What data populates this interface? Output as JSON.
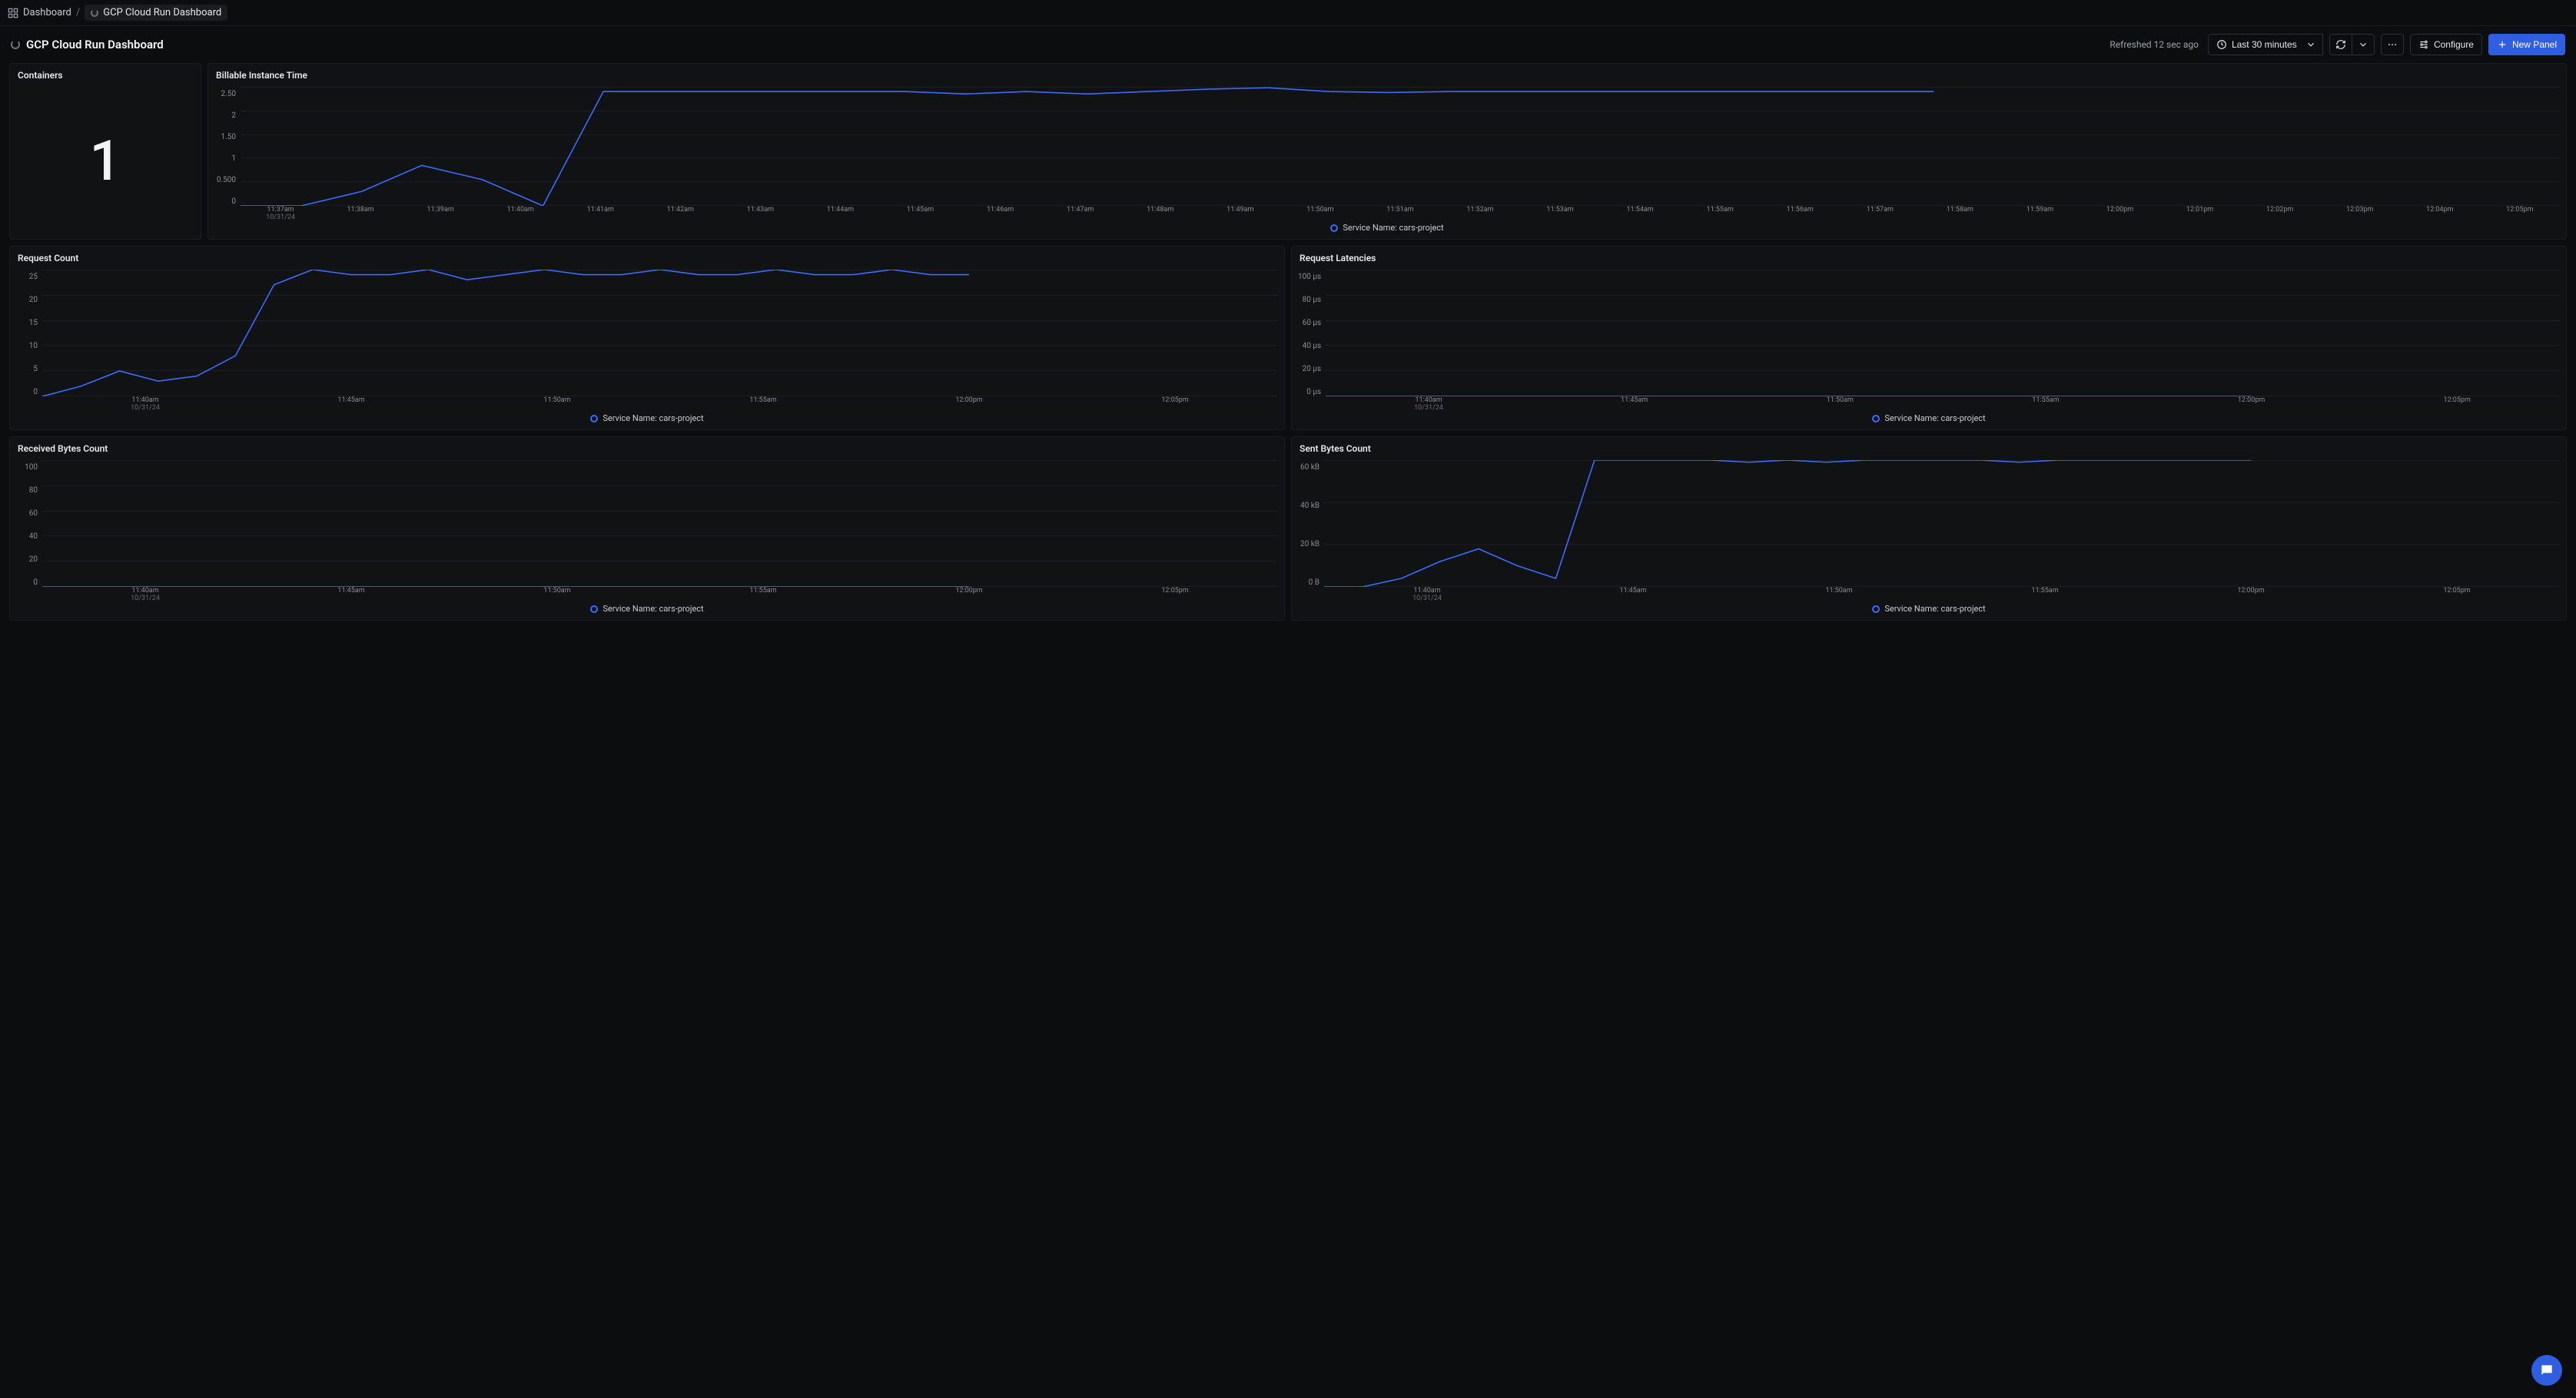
{
  "breadcrumb": {
    "root": "Dashboard",
    "sep": "/",
    "current": "GCP Cloud Run Dashboard"
  },
  "header": {
    "title": "GCP Cloud Run Dashboard",
    "refreshed": "Refreshed 12 sec ago",
    "range_label": "Last 30 minutes",
    "configure": "Configure",
    "new_panel": "New Panel"
  },
  "legend_label": "Service Name: cars-project",
  "date_label": "10/31/24",
  "panels": {
    "containers": {
      "title": "Containers",
      "value": "1"
    },
    "billable": {
      "title": "Billable Instance Time"
    },
    "req_count": {
      "title": "Request Count"
    },
    "req_lat": {
      "title": "Request Latencies"
    },
    "recv_bytes": {
      "title": "Received Bytes Count"
    },
    "sent_bytes": {
      "title": "Sent Bytes Count"
    }
  },
  "chart_data": [
    {
      "id": "billable",
      "type": "line",
      "title": "Billable Instance Time",
      "ylabel": "",
      "ylim": [
        0,
        2.5
      ],
      "yticks": [
        "2.50",
        "2",
        "1.50",
        "1",
        "0.500",
        "0"
      ],
      "xticks": [
        "11:37am",
        "11:38am",
        "11:39am",
        "11:40am",
        "11:41am",
        "11:42am",
        "11:43am",
        "11:44am",
        "11:45am",
        "11:46am",
        "11:47am",
        "11:48am",
        "11:49am",
        "11:50am",
        "11:51am",
        "11:52am",
        "11:53am",
        "11:54am",
        "11:55am",
        "11:56am",
        "11:57am",
        "11:58am",
        "11:59am",
        "12:00pm",
        "12:01pm",
        "12:02pm",
        "12:03pm",
        "12:04pm",
        "12:05pm"
      ],
      "series": [
        {
          "name": "Service Name: cars-project",
          "values": [
            0,
            0,
            0.3,
            0.85,
            0.55,
            0,
            2.4,
            2.4,
            2.4,
            2.4,
            2.4,
            2.4,
            2.35,
            2.4,
            2.35,
            2.4,
            2.45,
            2.48,
            2.4,
            2.38,
            2.4,
            2.4,
            2.4,
            2.4,
            2.4,
            2.4,
            2.4,
            2.4,
            2.4
          ]
        }
      ]
    },
    {
      "id": "req_count",
      "type": "line",
      "title": "Request Count",
      "ylim": [
        0,
        25
      ],
      "yticks": [
        "25",
        "20",
        "15",
        "10",
        "5",
        "0"
      ],
      "xticks": [
        "11:40am",
        "11:45am",
        "11:50am",
        "11:55am",
        "12:00pm",
        "12:05pm"
      ],
      "series": [
        {
          "name": "Service Name: cars-project",
          "values": [
            0,
            2,
            5,
            3,
            4,
            8,
            22,
            25,
            24,
            24,
            25,
            23,
            24,
            25,
            24,
            24,
            25,
            24,
            24,
            25,
            24,
            24,
            25,
            24,
            24
          ]
        }
      ]
    },
    {
      "id": "req_lat",
      "type": "line",
      "title": "Request Latencies",
      "ylim": [
        0,
        100
      ],
      "yticks": [
        "100 µs",
        "80 µs",
        "60 µs",
        "40 µs",
        "20 µs",
        "0 µs"
      ],
      "xticks": [
        "11:40am",
        "11:45am",
        "11:50am",
        "11:55am",
        "12:00pm",
        "12:05pm"
      ],
      "series": [
        {
          "name": "Service Name: cars-project",
          "values": [
            0,
            0,
            0,
            0,
            0,
            0,
            0,
            0,
            0,
            0,
            0,
            0,
            0,
            0,
            0,
            0,
            0,
            0,
            0,
            0,
            0,
            0,
            0,
            0,
            0
          ]
        }
      ]
    },
    {
      "id": "recv_bytes",
      "type": "line",
      "title": "Received Bytes Count",
      "ylim": [
        0,
        100
      ],
      "yticks": [
        "100",
        "80",
        "60",
        "40",
        "20",
        "0"
      ],
      "xticks": [
        "11:40am",
        "11:45am",
        "11:50am",
        "11:55am",
        "12:00pm",
        "12:05pm"
      ],
      "series": [
        {
          "name": "Service Name: cars-project",
          "values": [
            0,
            0,
            0,
            0,
            0,
            0,
            0,
            0,
            0,
            0,
            0,
            0,
            0,
            0,
            0,
            0,
            0,
            0,
            0,
            0,
            0,
            0,
            0,
            0,
            0
          ]
        }
      ]
    },
    {
      "id": "sent_bytes",
      "type": "line",
      "title": "Sent Bytes Count",
      "ylim": [
        0,
        60000
      ],
      "yticks": [
        "60 kB",
        "40 kB",
        "20 kB",
        "0 B"
      ],
      "xticks": [
        "11:40am",
        "11:45am",
        "11:50am",
        "11:55am",
        "12:00pm",
        "12:05pm"
      ],
      "series": [
        {
          "name": "Service Name: cars-project",
          "values": [
            0,
            0,
            4000,
            12000,
            18000,
            10000,
            4000,
            60000,
            60000,
            60000,
            60000,
            59000,
            60000,
            59000,
            60000,
            60000,
            60000,
            60000,
            59000,
            60000,
            60000,
            60000,
            60000,
            60000,
            60000
          ]
        }
      ]
    }
  ]
}
